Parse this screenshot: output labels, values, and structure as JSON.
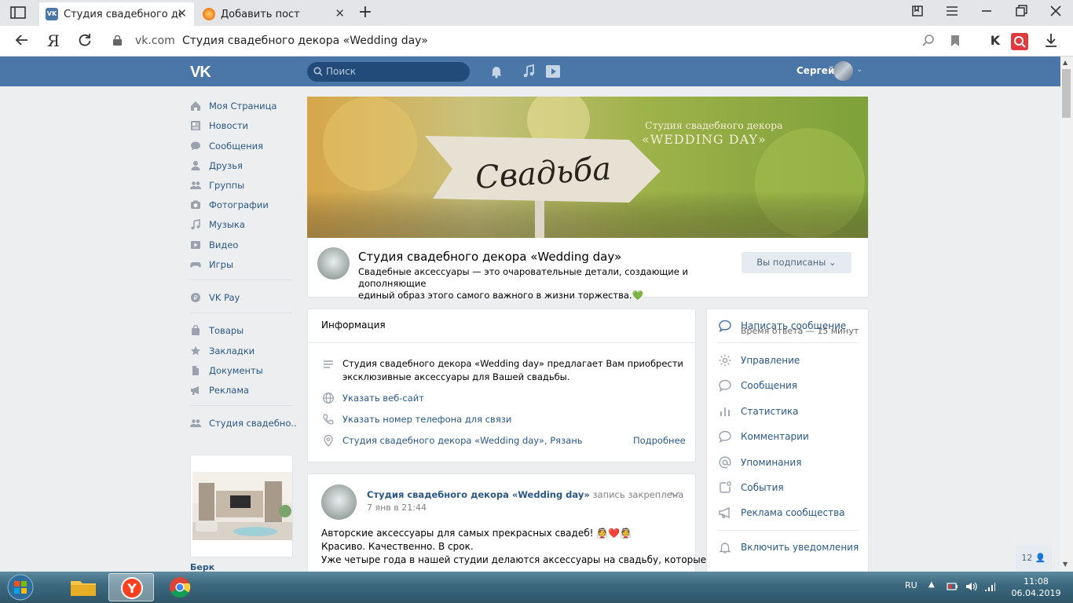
{
  "browser": {
    "tabs": [
      {
        "title": "Студия свадебного декора «Wedding day»",
        "favicon": "vk-icon",
        "active": true
      },
      {
        "title": "Добавить пост",
        "favicon": "blogger-icon",
        "active": false
      }
    ],
    "address": {
      "host": "vk.com",
      "page_title": "Студия свадебного декора «Wedding day»"
    },
    "yandex_letter": "Я"
  },
  "vk_header": {
    "logo": "VK",
    "search_placeholder": "Поиск",
    "user_name": "Сергей"
  },
  "left_menu": {
    "items": [
      {
        "label": "Моя Страница",
        "icon": "home-icon"
      },
      {
        "label": "Новости",
        "icon": "news-icon"
      },
      {
        "label": "Сообщения",
        "icon": "messages-icon"
      },
      {
        "label": "Друзья",
        "icon": "friends-icon"
      },
      {
        "label": "Группы",
        "icon": "groups-icon"
      },
      {
        "label": "Фотографии",
        "icon": "camera-icon"
      },
      {
        "label": "Музыка",
        "icon": "music-icon"
      },
      {
        "label": "Видео",
        "icon": "video-icon"
      },
      {
        "label": "Игры",
        "icon": "games-icon"
      },
      {
        "label": "VK Pay",
        "icon": "vkpay-icon"
      },
      {
        "label": "Товары",
        "icon": "bag-icon"
      },
      {
        "label": "Закладки",
        "icon": "star-icon"
      },
      {
        "label": "Документы",
        "icon": "document-icon"
      },
      {
        "label": "Реклама",
        "icon": "megaphone-icon"
      },
      {
        "label": "Студия свадебно..",
        "icon": "groups-icon"
      }
    ],
    "ad_name": "Берк"
  },
  "cover": {
    "brand_line1": "Студия свадебного декора",
    "brand_line2": "«WEDDING DAY»",
    "sign_text": "Свадьба"
  },
  "group": {
    "name": "Студия свадебного декора «Wedding day»",
    "status_line1": "Свадебные аксессуары — это очаровательные детали, создающие и дополняющие",
    "status_line2": "единый образ этого самого важного в жизни торжества.",
    "subscribe_label": "Вы подписаны"
  },
  "info": {
    "title": "Информация",
    "description_line1": "Студия свадебного декора «Wedding day» предлагает Вам приобрести",
    "description_line2": "эксклюзивные аксессуары для Вашей свадьбы.",
    "website": "Указать веб-сайт",
    "phone": "Указать номер телефона для связи",
    "address": "Студия свадебного декора «Wedding day», Рязань",
    "more": "Подробнее"
  },
  "post": {
    "author": "Студия свадебного декора «Wedding day»",
    "pinned": "запись закреплена",
    "date": "7 янв в 21:44",
    "line1": "Авторские аксессуары для самых прекрасных свадеб!",
    "line2": "Красиво. Качественно. В срок.",
    "line3": "Уже четыре года в нашей студии делаются аксессуары на свадьбу, которые"
  },
  "actions": {
    "write_message": "Написать сообщение",
    "response_time": "Время ответа — 15 минут",
    "items": [
      {
        "label": "Управление",
        "icon": "gear-icon"
      },
      {
        "label": "Сообщения",
        "icon": "chat-icon"
      },
      {
        "label": "Статистика",
        "icon": "stats-icon"
      },
      {
        "label": "Комментарии",
        "icon": "comment-icon"
      },
      {
        "label": "Упоминания",
        "icon": "at-icon"
      },
      {
        "label": "События",
        "icon": "events-icon"
      },
      {
        "label": "Реклама сообщества",
        "icon": "megaphone-icon"
      }
    ],
    "notifications": "Включить уведомления"
  },
  "counter": "12",
  "taskbar": {
    "lang": "RU",
    "time": "11:08",
    "date": "06.04.2019"
  },
  "colors": {
    "vk_blue": "#4a76a8",
    "link": "#2a5885",
    "background": "#edeef0"
  }
}
